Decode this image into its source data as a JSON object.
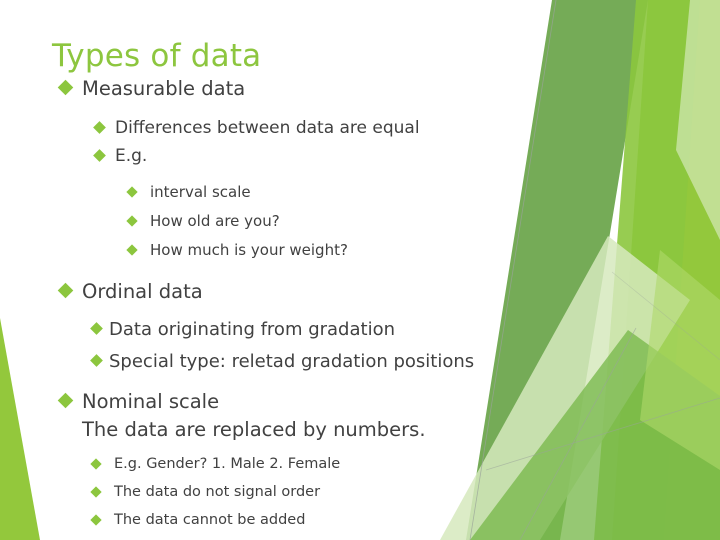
{
  "slide": {
    "title": "Types of data",
    "title_color": "#8DC63F",
    "body_text_color": "#414141",
    "bullet_color": "#8CC63E",
    "background_color": "#FFFFFF"
  },
  "content": [
    {
      "level": 1,
      "text": "Measurable data",
      "bullet": "diamond-bullet-icon"
    },
    {
      "level": 2,
      "text": "Differences between data are equal",
      "bullet": "diamond-bullet-icon"
    },
    {
      "level": 2,
      "text": "E.g.",
      "bullet": "diamond-bullet-icon"
    },
    {
      "level": 3,
      "text": "interval scale",
      "bullet": "diamond-bullet-icon"
    },
    {
      "level": 3,
      "text": "How old are you?",
      "bullet": "diamond-bullet-icon"
    },
    {
      "level": 3,
      "text": "How much is your weight?",
      "bullet": "diamond-bullet-icon"
    },
    {
      "level": 1,
      "text": "Ordinal data",
      "bullet": "diamond-bullet-icon"
    },
    {
      "level": 2,
      "text": "Data originating from gradation",
      "bullet": "diamond-bullet-icon"
    },
    {
      "level": 2,
      "text": "Special type: reletad gradation positions",
      "bullet": "diamond-bullet-icon"
    },
    {
      "level": 1,
      "text": "Nominal scale",
      "subline": "The data are replaced by numbers.",
      "bullet": "diamond-bullet-icon"
    },
    {
      "level": 3,
      "text": "E.g. Gender? 1. Male 2. Female",
      "bullet": "diamond-bullet-icon"
    },
    {
      "level": 3,
      "text": "The data do not signal order",
      "bullet": "diamond-bullet-icon"
    },
    {
      "level": 3,
      "text": "The data cannot be added",
      "bullet": "diamond-bullet-icon"
    }
  ],
  "decoration": {
    "name": "green-angled-polygons",
    "palette": {
      "dark_green": "#6EA64E",
      "mid_green": "#79B84B",
      "bright_green": "#8CC63E",
      "lime_green": "#93C83C",
      "pale_green": "#D6E9BD",
      "very_pale_green": "#E8F2D9",
      "hairline": "#9AA39A"
    }
  }
}
